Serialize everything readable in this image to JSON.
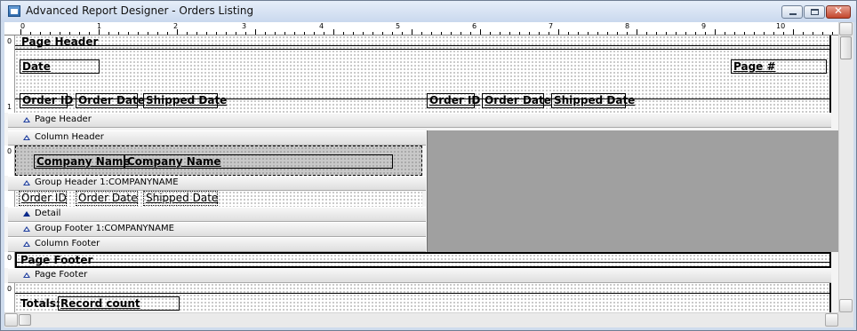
{
  "window": {
    "title": "Advanced Report Designer - Orders Listing",
    "controls": {
      "minimize": "minimize",
      "maximize": "maximize",
      "close": "✕"
    }
  },
  "ruler": {
    "labels": [
      "0",
      "1",
      "2",
      "3",
      "4",
      "5",
      "6",
      "7",
      "8",
      "9",
      "10"
    ]
  },
  "vruler": {
    "labels": [
      "0",
      "1"
    ]
  },
  "bands": {
    "page_header": {
      "title": "Page Header",
      "date": "Date",
      "page_number": "Page #",
      "columns_left": [
        "Order ID",
        "Order Date",
        "Shipped Date"
      ],
      "columns_right": [
        "Order ID",
        "Order Date",
        "Shipped Date"
      ],
      "bar_label": "Page Header"
    },
    "column_header": {
      "bar_label": "Column Header"
    },
    "group_header": {
      "company_label": "Company Name",
      "company_field": "Company Name",
      "bar_label": "Group Header 1:COMPANYNAME"
    },
    "detail": {
      "fields": [
        "Order ID",
        "Order Date",
        "Shipped Date"
      ],
      "bar_label": "Detail"
    },
    "group_footer": {
      "bar_label": "Group Footer 1:COMPANYNAME"
    },
    "column_footer": {
      "bar_label": "Column Footer"
    },
    "page_footer": {
      "title": "Page Footer",
      "bar_label": "Page Footer"
    },
    "report_footer": {
      "totals_label": "Totals:",
      "record_count": "Record count"
    }
  }
}
